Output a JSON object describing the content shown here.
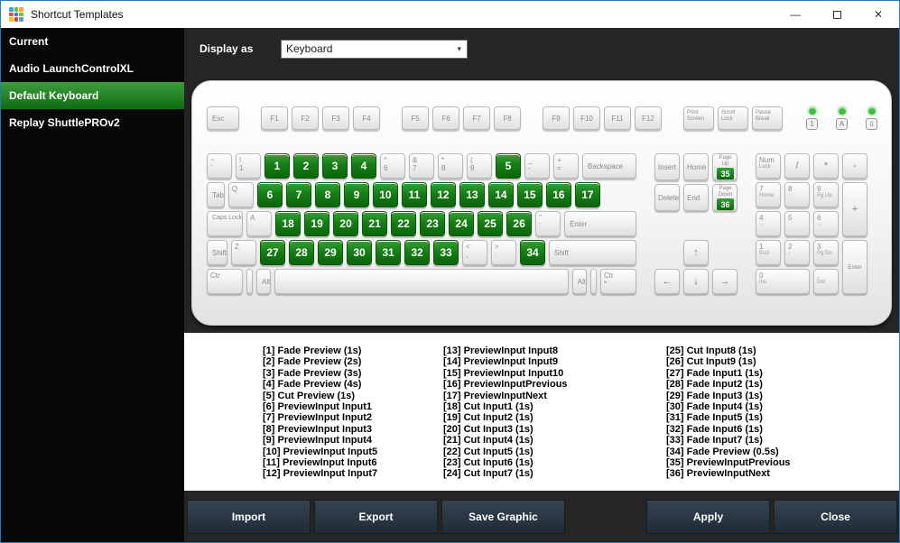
{
  "window": {
    "title": "Shortcut Templates",
    "minimize_label": "—",
    "close_label": "✕"
  },
  "sidebar": {
    "items": [
      {
        "label": "Current",
        "selected": false
      },
      {
        "label": "Audio LaunchControlXL",
        "selected": false
      },
      {
        "label": "Default Keyboard",
        "selected": true
      },
      {
        "label": "Replay ShuttlePROv2",
        "selected": false
      }
    ]
  },
  "toolbar": {
    "display_as_label": "Display as",
    "display_as_value": "Keyboard"
  },
  "keyboard": {
    "esc": "Esc",
    "fkey_groups": [
      [
        "F1",
        "F2",
        "F3",
        "F4"
      ],
      [
        "F5",
        "F6",
        "F7",
        "F8"
      ],
      [
        "F9",
        "F10",
        "F11",
        "F12"
      ]
    ],
    "system_keys": [
      "Print Screen",
      "Scroll Lock",
      "Pause Break"
    ],
    "leds": [
      {
        "name": "num-lock-led",
        "icon": "1"
      },
      {
        "name": "caps-lock-led",
        "icon": "A"
      },
      {
        "name": "scroll-lock-led",
        "icon": "⇩"
      }
    ],
    "main_rows": [
      [
        {
          "l1": "~",
          "l2": "`",
          "n": "backtick"
        },
        {
          "l1": "!",
          "l2": "1"
        },
        {
          "g": "1"
        },
        {
          "g": "2"
        },
        {
          "g": "3"
        },
        {
          "g": "4"
        },
        {
          "l1": "^",
          "l2": "6"
        },
        {
          "l1": "&",
          "l2": "7"
        },
        {
          "l1": "*",
          "l2": "8"
        },
        {
          "l1": "(",
          "l2": "9"
        },
        {
          "g": "5"
        },
        {
          "l1": "_",
          "l2": "-",
          "n": "minus"
        },
        {
          "l1": "+",
          "l2": "=",
          "n": "equals"
        },
        {
          "label": "Backspace",
          "cls": "grow"
        }
      ],
      [
        {
          "label": "Tab",
          "cls": "w44"
        },
        {
          "l1": "Q"
        },
        {
          "g": "6"
        },
        {
          "g": "7"
        },
        {
          "g": "8"
        },
        {
          "g": "9"
        },
        {
          "g": "10"
        },
        {
          "g": "11"
        },
        {
          "g": "12"
        },
        {
          "g": "13"
        },
        {
          "g": "14"
        },
        {
          "g": "15"
        },
        {
          "g": "16"
        },
        {
          "g": "17"
        }
      ],
      [
        {
          "label": "Caps Lock",
          "cls": "w54 two"
        },
        {
          "l1": "A"
        },
        {
          "g": "18"
        },
        {
          "g": "19"
        },
        {
          "g": "20"
        },
        {
          "g": "21"
        },
        {
          "g": "22"
        },
        {
          "g": "23"
        },
        {
          "g": "24"
        },
        {
          "g": "25"
        },
        {
          "g": "26"
        },
        {
          "l1": "\"",
          "l2": "'",
          "n": "quote"
        },
        {
          "label": "Enter",
          "cls": "grow"
        }
      ],
      [
        {
          "label": "Shift",
          "cls": "w64",
          "n": "shift-left"
        },
        {
          "l1": "Z"
        },
        {
          "g": "27"
        },
        {
          "g": "28"
        },
        {
          "g": "29"
        },
        {
          "g": "30"
        },
        {
          "g": "31"
        },
        {
          "g": "32"
        },
        {
          "g": "33"
        },
        {
          "l1": "<",
          "l2": ",",
          "n": "comma"
        },
        {
          "l1": ">",
          "l2": ".",
          "n": "period"
        },
        {
          "g": "34"
        },
        {
          "label": "Shift",
          "cls": "grow",
          "n": "shift-right"
        }
      ],
      [
        {
          "l1": "Ctr",
          "cls": "w40",
          "n": "ctr-left"
        },
        {
          "label": "",
          "cls": "w34",
          "n": "blank-left"
        },
        {
          "label": "Alt",
          "cls": "w34",
          "n": "alt-left"
        },
        {
          "label": "",
          "cls": "grow",
          "n": "space"
        },
        {
          "label": "Alt",
          "cls": "w34",
          "n": "alt-right"
        },
        {
          "label": "",
          "cls": "w34",
          "n": "blank-right"
        },
        {
          "l1": "Ctr",
          "l2": "*",
          "cls": "w40",
          "n": "ctr-right"
        }
      ]
    ],
    "nav_rows": [
      [
        {
          "label": "Insert"
        },
        {
          "label": "Home"
        },
        {
          "label": "Page Up",
          "badge": "35",
          "n": "page-up"
        }
      ],
      [
        {
          "label": "Delete"
        },
        {
          "label": "End"
        },
        {
          "label": "Page Down",
          "badge": "36",
          "n": "page-down"
        }
      ]
    ],
    "arrow_keys": {
      "up": "↑",
      "left": "←",
      "down": "↓",
      "right": "→"
    },
    "numpad": [
      {
        "l1": "Num",
        "l2": "Lock",
        "n": "num-lock"
      },
      {
        "c": "/",
        "n": "divide"
      },
      {
        "c": "*",
        "n": "multiply"
      },
      {
        "c": "-",
        "n": "minus"
      },
      {
        "l1": "7",
        "l2": "Home",
        "n": "7"
      },
      {
        "l1": "8",
        "l2": "↑",
        "n": "8"
      },
      {
        "l1": "9",
        "l2": "Pg Up",
        "n": "9"
      },
      {
        "c": "+",
        "n": "plus",
        "span": "row"
      },
      {
        "l1": "4",
        "l2": "←",
        "n": "4"
      },
      {
        "l1": "5",
        "l2": "",
        "n": "5"
      },
      {
        "l1": "6",
        "l2": "→",
        "n": "6"
      },
      {
        "l1": "1",
        "l2": "End",
        "n": "1"
      },
      {
        "l1": "2",
        "l2": "↓",
        "n": "2"
      },
      {
        "l1": "3",
        "l2": "Pg Dn",
        "n": "3"
      },
      {
        "c": "Enter",
        "n": "enter",
        "span": "row",
        "cls": "small"
      },
      {
        "l1": "0",
        "l2": "Ins",
        "n": "0",
        "span": "col"
      },
      {
        "l1": ".",
        "l2": "Del",
        "n": "decimal"
      }
    ]
  },
  "shortcuts": {
    "columns": [
      [
        "[1] Fade Preview (1s)",
        "[2] Fade Preview (2s)",
        "[3] Fade Preview (3s)",
        "[4] Fade Preview (4s)",
        "[5] Cut Preview (1s)",
        "[6] PreviewInput Input1",
        "[7] PreviewInput Input2",
        "[8] PreviewInput Input3",
        "[9] PreviewInput Input4",
        "[10] PreviewInput Input5",
        "[11] PreviewInput Input6",
        "[12] PreviewInput Input7"
      ],
      [
        "[13] PreviewInput Input8",
        "[14] PreviewInput Input9",
        "[15] PreviewInput Input10",
        "[16] PreviewInputPrevious",
        "[17] PreviewInputNext",
        "[18] Cut Input1 (1s)",
        "[19] Cut Input2 (1s)",
        "[20] Cut Input3 (1s)",
        "[21] Cut Input4 (1s)",
        "[22] Cut Input5 (1s)",
        "[23] Cut Input6 (1s)",
        "[24] Cut Input7 (1s)"
      ],
      [
        "[25] Cut Input8 (1s)",
        "[26] Cut Input9 (1s)",
        "[27] Fade Input1 (1s)",
        "[28] Fade Input2 (1s)",
        "[29] Fade Input3 (1s)",
        "[30] Fade Input4 (1s)",
        "[31] Fade Input5 (1s)",
        "[32] Fade Input6 (1s)",
        "[33] Fade Input7 (1s)",
        "[34] Fade Preview (0.5s)",
        "[35] PreviewInputPrevious",
        "[36] PreviewInputNext"
      ]
    ]
  },
  "footer": {
    "left_buttons": [
      "Import",
      "Export",
      "Save Graphic"
    ],
    "right_buttons": [
      "Apply",
      "Close"
    ]
  }
}
